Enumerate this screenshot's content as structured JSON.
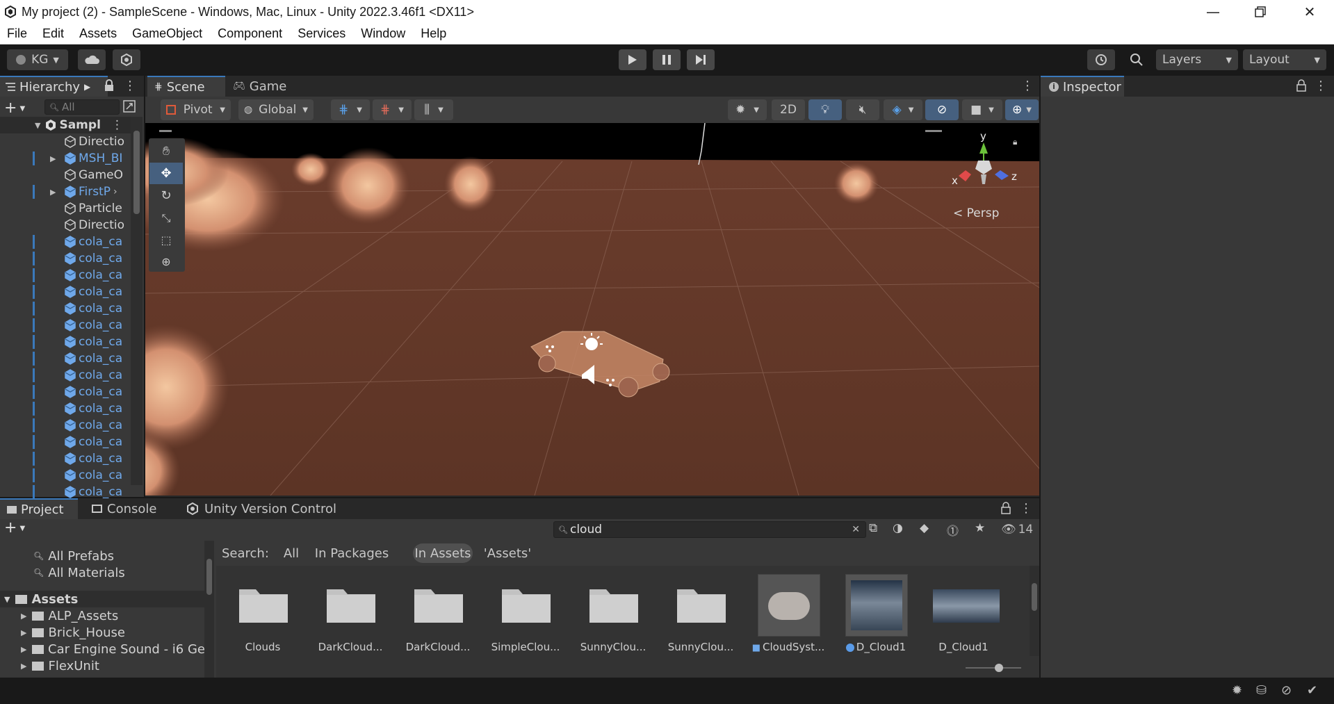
{
  "title": "My project (2) - SampleScene - Windows, Mac, Linux - Unity 2022.3.46f1 <DX11>",
  "menu": [
    "File",
    "Edit",
    "Assets",
    "GameObject",
    "Component",
    "Services",
    "Window",
    "Help"
  ],
  "toolbar": {
    "account": "KG",
    "layers": "Layers",
    "layout": "Layout"
  },
  "hierarchy": {
    "tab": "Hierarchy",
    "search_placeholder": "All",
    "scene": "Sampl",
    "items": [
      {
        "label": "Directio",
        "blue": false,
        "arrow": false
      },
      {
        "label": "MSH_BI",
        "blue": true,
        "arrow": true
      },
      {
        "label": "GameO",
        "blue": false,
        "arrow": false
      },
      {
        "label": "FirstP",
        "blue": true,
        "arrow": true
      },
      {
        "label": "Particle",
        "blue": false,
        "arrow": false
      },
      {
        "label": "Directio",
        "blue": false,
        "arrow": false
      },
      {
        "label": "cola_ca",
        "blue": true,
        "arrow": false
      },
      {
        "label": "cola_ca",
        "blue": true,
        "arrow": false
      },
      {
        "label": "cola_ca",
        "blue": true,
        "arrow": false
      },
      {
        "label": "cola_ca",
        "blue": true,
        "arrow": false
      },
      {
        "label": "cola_ca",
        "blue": true,
        "arrow": false
      },
      {
        "label": "cola_ca",
        "blue": true,
        "arrow": false
      },
      {
        "label": "cola_ca",
        "blue": true,
        "arrow": false
      },
      {
        "label": "cola_ca",
        "blue": true,
        "arrow": false
      },
      {
        "label": "cola_ca",
        "blue": true,
        "arrow": false
      },
      {
        "label": "cola_ca",
        "blue": true,
        "arrow": false
      },
      {
        "label": "cola_ca",
        "blue": true,
        "arrow": false
      },
      {
        "label": "cola_ca",
        "blue": true,
        "arrow": false
      },
      {
        "label": "cola_ca",
        "blue": true,
        "arrow": false
      },
      {
        "label": "cola_ca",
        "blue": true,
        "arrow": false
      },
      {
        "label": "cola_ca",
        "blue": true,
        "arrow": false
      },
      {
        "label": "cola_ca",
        "blue": true,
        "arrow": false
      }
    ]
  },
  "scene": {
    "tabs": [
      "Scene",
      "Game"
    ],
    "pivot": "Pivot",
    "global": "Global",
    "mode_2d": "2D",
    "persp": "Persp",
    "gizmo": {
      "y": "y",
      "x": "x",
      "z": "z"
    }
  },
  "inspector": {
    "tab": "Inspector"
  },
  "bottom": {
    "tabs": [
      "Project",
      "Console",
      "Unity Version Control"
    ],
    "search_value": "cloud",
    "hidden_count": "14",
    "search_label": "Search:",
    "scopes": [
      "All",
      "In Packages",
      "In Assets",
      "'Assets'"
    ],
    "favorites": [
      "All Prefabs",
      "All Materials"
    ],
    "assets_root": "Assets",
    "folders": [
      "ALP_Assets",
      "Brick_House",
      "Car Engine Sound - i6 Ge",
      "FlexUnit"
    ],
    "assets": [
      {
        "label": "Clouds",
        "kind": "folder"
      },
      {
        "label": "DarkCloud...",
        "kind": "folder"
      },
      {
        "label": "DarkCloud...",
        "kind": "folder"
      },
      {
        "label": "SimpleClou...",
        "kind": "folder"
      },
      {
        "label": "SunnyClou...",
        "kind": "folder"
      },
      {
        "label": "SunnyClou...",
        "kind": "folder"
      },
      {
        "label": "CloudSyst...",
        "kind": "prefab"
      },
      {
        "label": "D_Cloud1",
        "kind": "material"
      },
      {
        "label": "D_Cloud1",
        "kind": "texture"
      }
    ]
  },
  "colors": {
    "accent": "#3a79bb",
    "prefab_blue": "#6fa8ea",
    "ground": "#6b3b2a"
  }
}
